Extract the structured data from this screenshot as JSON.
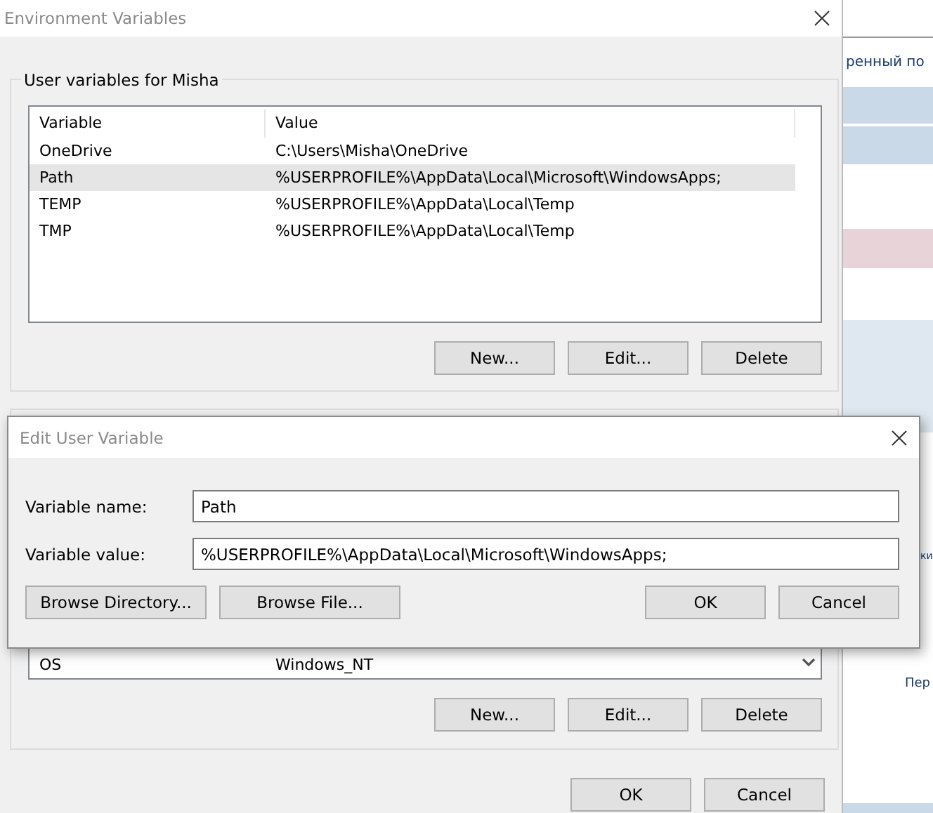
{
  "background_window": {
    "texts": [
      "ренный по",
      "ки",
      "Пер"
    ]
  },
  "window": {
    "title": "Environment Variables"
  },
  "user_variables": {
    "title": "User variables for Misha",
    "columns": [
      "Variable",
      "Value"
    ],
    "rows": [
      {
        "variable": "OneDrive",
        "value": "C:\\Users\\Misha\\OneDrive",
        "selected": false
      },
      {
        "variable": "Path",
        "value": "%USERPROFILE%\\AppData\\Local\\Microsoft\\WindowsApps;",
        "selected": true
      },
      {
        "variable": "TEMP",
        "value": "%USERPROFILE%\\AppData\\Local\\Temp",
        "selected": false
      },
      {
        "variable": "TMP",
        "value": "%USERPROFILE%\\AppData\\Local\\Temp",
        "selected": false
      }
    ],
    "buttons": [
      "New...",
      "Edit...",
      "Delete"
    ]
  },
  "system_variables": {
    "rows": [
      {
        "variable": "OS",
        "value": "Windows_NT",
        "selected": false
      }
    ],
    "buttons": [
      "New...",
      "Edit...",
      "Delete"
    ]
  },
  "dialog_buttons": [
    "OK",
    "Cancel"
  ],
  "edit_dialog": {
    "title": "Edit User Variable",
    "fields": [
      {
        "label": "Variable name:",
        "value": "Path"
      },
      {
        "label": "Variable value:",
        "value": "%USERPROFILE%\\AppData\\Local\\Microsoft\\WindowsApps;"
      }
    ],
    "left_buttons": [
      "Browse Directory...",
      "Browse File..."
    ],
    "right_buttons": [
      "OK",
      "Cancel"
    ]
  }
}
